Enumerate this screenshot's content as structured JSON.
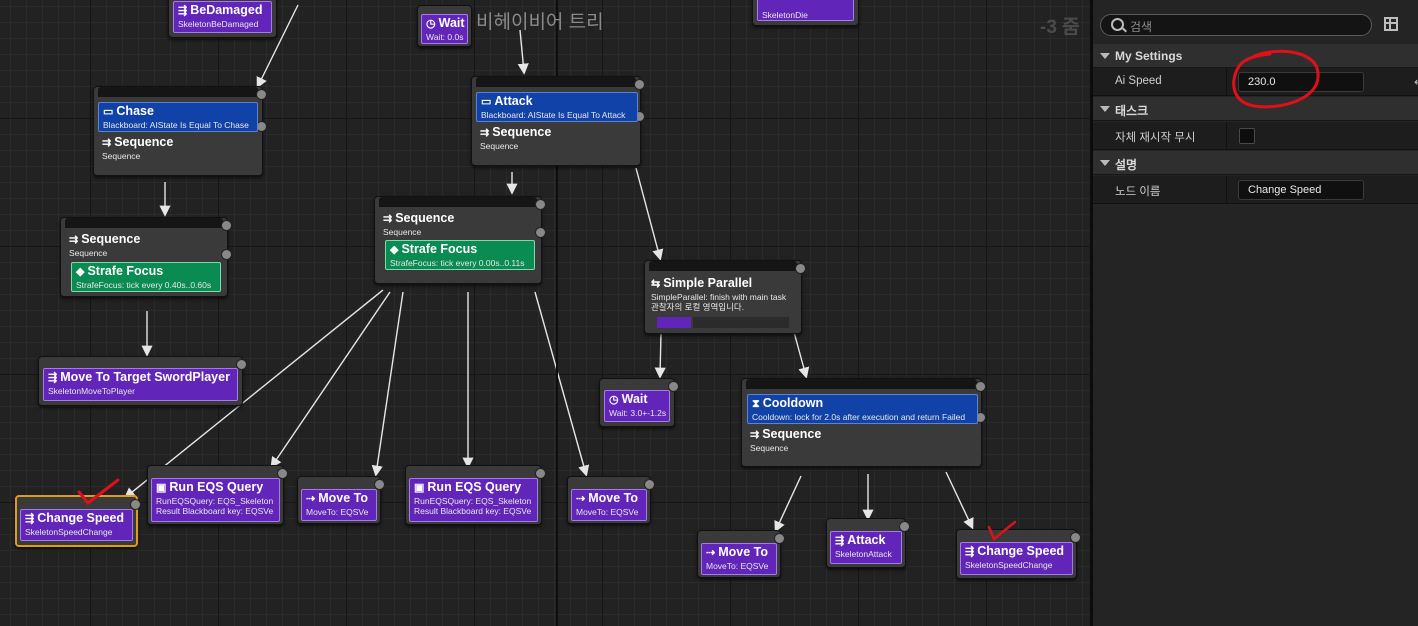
{
  "graph": {
    "title": "비헤이비어 트리",
    "zoom": "-3 줌"
  },
  "nodes": {
    "bedamaged": {
      "title": "BeDamaged",
      "sub": "SkeletonBeDamaged"
    },
    "wait_top": {
      "title": "Wait",
      "sub": "Wait: 0.0s"
    },
    "skeletondie": {
      "sub": "SkeletonDie"
    },
    "chase": {
      "dec_title": "Chase",
      "dec_sub": "Blackboard: AIState Is Equal To Chase",
      "title": "Sequence",
      "sub": "Sequence"
    },
    "attack_seq": {
      "dec_title": "Attack",
      "dec_sub": "Blackboard: AIState Is Equal To Attack",
      "title": "Sequence",
      "sub": "Sequence"
    },
    "seq_left": {
      "title": "Sequence",
      "sub": "Sequence",
      "svc_title": "Strafe Focus",
      "svc_sub": "StrafeFocus: tick every 0.40s..0.60s"
    },
    "seq_mid": {
      "title": "Sequence",
      "sub": "Sequence",
      "svc_title": "Strafe Focus",
      "svc_sub": "StrafeFocus: tick every 0.00s..0.11s"
    },
    "simple_parallel": {
      "title": "Simple Parallel",
      "sub": "SimpleParallel: finish with main task",
      "sub2": "관찰자의 로컬 영역입니다."
    },
    "move_target": {
      "title": "Move To Target SwordPlayer",
      "sub": "SkeletonMoveToPlayer"
    },
    "wait_mid": {
      "title": "Wait",
      "sub": "Wait: 3.0+-1.2s"
    },
    "cooldown": {
      "dec_title": "Cooldown",
      "dec_sub": "Cooldown: lock for 2.0s after execution and return Failed",
      "title": "Sequence",
      "sub": "Sequence"
    },
    "change_speed_1": {
      "title": "Change Speed",
      "sub": "SkeletonSpeedChange"
    },
    "run_eqs_1": {
      "title": "Run EQS Query",
      "sub": "RunEQSQuery: EQS_Skeleton",
      "sub2": "Result Blackboard key: EQSVe"
    },
    "move_to_1": {
      "title": "Move To",
      "sub": "MoveTo: EQSVe"
    },
    "run_eqs_2": {
      "title": "Run EQS Query",
      "sub": "RunEQSQuery: EQS_Skeleton",
      "sub2": "Result Blackboard key: EQSVe"
    },
    "move_to_2": {
      "title": "Move To",
      "sub": "MoveTo: EQSVe"
    },
    "move_to_3": {
      "title": "Move To",
      "sub": "MoveTo: EQSVe"
    },
    "attack_task": {
      "title": "Attack",
      "sub": "SkeletonAttack"
    },
    "change_speed_2": {
      "title": "Change Speed",
      "sub": "SkeletonSpeedChange"
    }
  },
  "details": {
    "search_placeholder": "검색",
    "categories": {
      "my_settings": "My Settings",
      "task": "태스크",
      "description": "설명"
    },
    "rows": {
      "ai_speed": {
        "label": "Ai Speed",
        "value": "230.0"
      },
      "ignore_restart": {
        "label": "자체 재시작 무시",
        "checked": false
      },
      "node_name": {
        "label": "노드 이름",
        "value": "Change Speed"
      }
    }
  },
  "colors": {
    "decorator": "#1142a8",
    "service": "#098b52",
    "task": "#6125b9",
    "selected_outline": "#e09a1c",
    "annotation_red": "#e0101a"
  }
}
